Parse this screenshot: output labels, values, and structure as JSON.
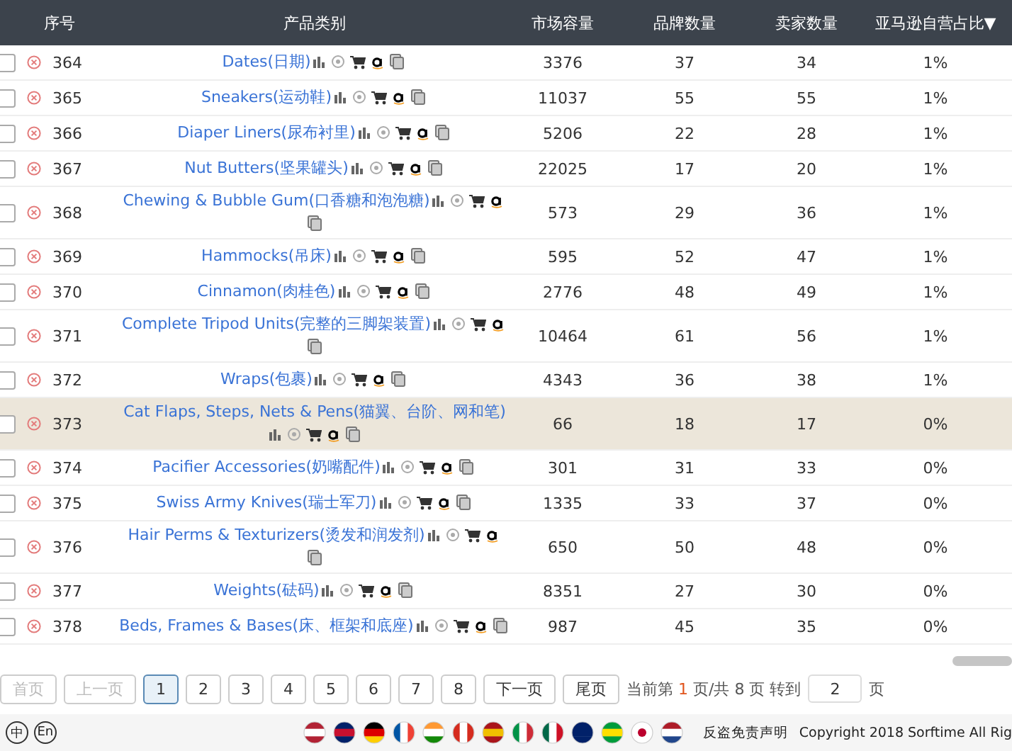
{
  "table": {
    "columns": [
      {
        "label": "序号"
      },
      {
        "label": "产品类别"
      },
      {
        "label": "市场容量"
      },
      {
        "label": "品牌数量"
      },
      {
        "label": "卖家数量"
      },
      {
        "label": "亚马逊自营占比",
        "sort_indicator": "▼"
      }
    ],
    "rows": [
      {
        "number": "364",
        "category": "Dates(日期)",
        "market_size": "3376",
        "brands": "37",
        "sellers": "34",
        "amazon_share": "1%",
        "checked": false,
        "highlighted": false
      },
      {
        "number": "365",
        "category": "Sneakers(运动鞋)",
        "market_size": "11037",
        "brands": "55",
        "sellers": "55",
        "amazon_share": "1%",
        "checked": false,
        "highlighted": false
      },
      {
        "number": "366",
        "category": "Diaper Liners(尿布衬里)",
        "market_size": "5206",
        "brands": "22",
        "sellers": "28",
        "amazon_share": "1%",
        "checked": false,
        "highlighted": false
      },
      {
        "number": "367",
        "category": "Nut Butters(坚果罐头)",
        "market_size": "22025",
        "brands": "17",
        "sellers": "20",
        "amazon_share": "1%",
        "checked": false,
        "highlighted": false
      },
      {
        "number": "368",
        "category": "Chewing & Bubble Gum(口香糖和泡泡糖)",
        "market_size": "573",
        "brands": "29",
        "sellers": "36",
        "amazon_share": "1%",
        "checked": false,
        "highlighted": false
      },
      {
        "number": "369",
        "category": "Hammocks(吊床)",
        "market_size": "595",
        "brands": "52",
        "sellers": "47",
        "amazon_share": "1%",
        "checked": false,
        "highlighted": false
      },
      {
        "number": "370",
        "category": "Cinnamon(肉桂色)",
        "market_size": "2776",
        "brands": "48",
        "sellers": "49",
        "amazon_share": "1%",
        "checked": false,
        "highlighted": false
      },
      {
        "number": "371",
        "category": "Complete Tripod Units(完整的三脚架装置)",
        "market_size": "10464",
        "brands": "61",
        "sellers": "56",
        "amazon_share": "1%",
        "checked": false,
        "highlighted": false
      },
      {
        "number": "372",
        "category": "Wraps(包裹)",
        "market_size": "4343",
        "brands": "36",
        "sellers": "38",
        "amazon_share": "1%",
        "checked": false,
        "highlighted": false
      },
      {
        "number": "373",
        "category": "Cat Flaps, Steps, Nets & Pens(猫翼、台阶、网和笔)",
        "market_size": "66",
        "brands": "18",
        "sellers": "17",
        "amazon_share": "0%",
        "checked": false,
        "highlighted": true
      },
      {
        "number": "374",
        "category": "Pacifier Accessories(奶嘴配件)",
        "market_size": "301",
        "brands": "31",
        "sellers": "33",
        "amazon_share": "0%",
        "checked": false,
        "highlighted": false
      },
      {
        "number": "375",
        "category": "Swiss Army Knives(瑞士军刀)",
        "market_size": "1335",
        "brands": "33",
        "sellers": "37",
        "amazon_share": "0%",
        "checked": false,
        "highlighted": false
      },
      {
        "number": "376",
        "category": "Hair Perms & Texturizers(烫发和润发剂)",
        "market_size": "650",
        "brands": "50",
        "sellers": "48",
        "amazon_share": "0%",
        "checked": false,
        "highlighted": false
      },
      {
        "number": "377",
        "category": "Weights(砝码)",
        "market_size": "8351",
        "brands": "27",
        "sellers": "30",
        "amazon_share": "0%",
        "checked": false,
        "highlighted": false
      },
      {
        "number": "378",
        "category": "Beds, Frames & Bases(床、框架和底座)",
        "market_size": "987",
        "brands": "45",
        "sellers": "35",
        "amazon_share": "0%",
        "checked": false,
        "highlighted": false
      }
    ]
  },
  "pagination": {
    "first": {
      "label": "首页",
      "disabled": true
    },
    "prev": {
      "label": "上一页",
      "disabled": true
    },
    "pages": [
      {
        "label": "1",
        "selected": true
      },
      {
        "label": "2",
        "selected": false
      },
      {
        "label": "3",
        "selected": false
      },
      {
        "label": "4",
        "selected": false
      },
      {
        "label": "5",
        "selected": false
      },
      {
        "label": "6",
        "selected": false
      },
      {
        "label": "7",
        "selected": false
      },
      {
        "label": "8",
        "selected": false
      }
    ],
    "next": {
      "label": "下一页",
      "disabled": false
    },
    "last": {
      "label": "尾页",
      "disabled": false
    },
    "status_prefix": "当前第",
    "current": "1",
    "status_suffix": "页/共 8 页 转到",
    "goto_value": "2",
    "goto_unit": "页"
  },
  "footer": {
    "languages": [
      {
        "label": "中"
      },
      {
        "label": "En"
      }
    ],
    "disclaimer": "反盗免责声明",
    "copyright": "Copyright 2018 Sorftime All Rig"
  }
}
